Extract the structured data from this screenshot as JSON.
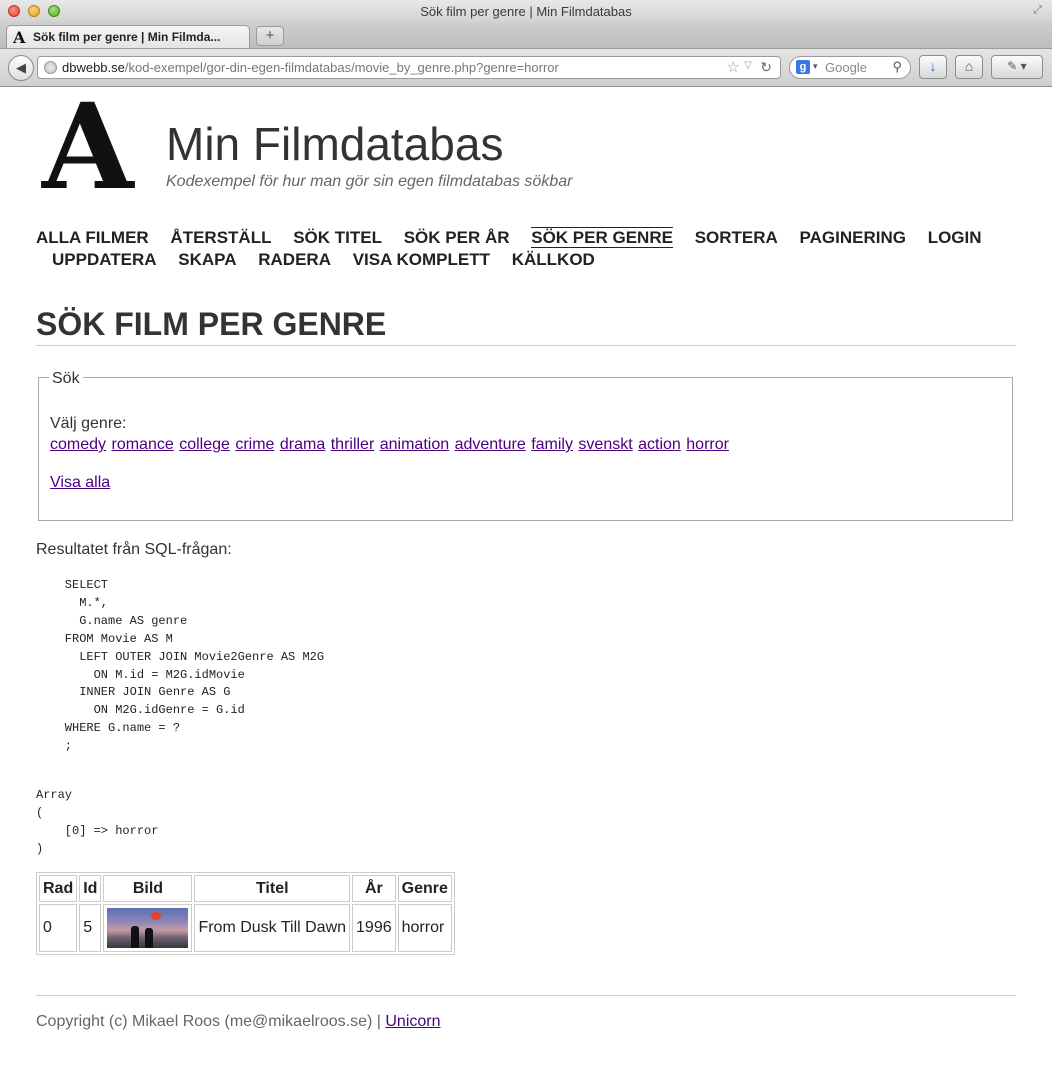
{
  "browser": {
    "window_title": "Sök film per genre | Min Filmdatabas",
    "tab_title": "Sök film per genre | Min Filmda...",
    "url_host": "dbwebb.se",
    "url_path": "/kod-exempel/gor-din-egen-filmdatabas/movie_by_genre.php?genre=horror",
    "search_placeholder": "Google",
    "favicon_letter": "A"
  },
  "site": {
    "logo_letter": "A",
    "title": "Min Filmdatabas",
    "slogan": "Kodexempel för hur man gör sin egen filmdatabas sökbar"
  },
  "nav": {
    "selected": "Sök per genre",
    "items_row1": [
      "Alla filmer",
      "Återställ",
      "Sök titel",
      "Sök per år",
      "Sök per genre",
      "Sortera",
      "Paginering",
      "Login"
    ],
    "items_row2": [
      "Uppdatera",
      "Skapa",
      "Radera",
      "Visa komplett",
      "Källkod"
    ]
  },
  "main": {
    "heading": "Sök film per genre",
    "search": {
      "legend": "Sök",
      "genre_label": "Välj genre:",
      "genres": [
        "comedy",
        "romance",
        "college",
        "crime",
        "drama",
        "thriller",
        "animation",
        "adventure",
        "family",
        "svenskt",
        "action",
        "horror"
      ],
      "show_all": "Visa alla"
    },
    "result_label": "Resultatet från SQL-frågan:",
    "sql": "    SELECT\n      M.*,\n      G.name AS genre\n    FROM Movie AS M\n      LEFT OUTER JOIN Movie2Genre AS M2G\n        ON M.id = M2G.idMovie\n      INNER JOIN Genre AS G\n        ON M2G.idGenre = G.id\n    WHERE G.name = ?\n    ;",
    "params": "Array\n(\n    [0] => horror\n)",
    "table": {
      "headers": [
        "Rad",
        "Id",
        "Bild",
        "Titel",
        "År",
        "Genre"
      ],
      "rows": [
        {
          "rad": "0",
          "id": "5",
          "titel": "From Dusk Till Dawn",
          "ar": "1996",
          "genre": "horror"
        }
      ]
    }
  },
  "footer": {
    "text": "Copyright (c) Mikael Roos (me@mikaelroos.se) | ",
    "link": "Unicorn"
  },
  "colors": {
    "link": "#4b0082",
    "text": "#333333"
  }
}
